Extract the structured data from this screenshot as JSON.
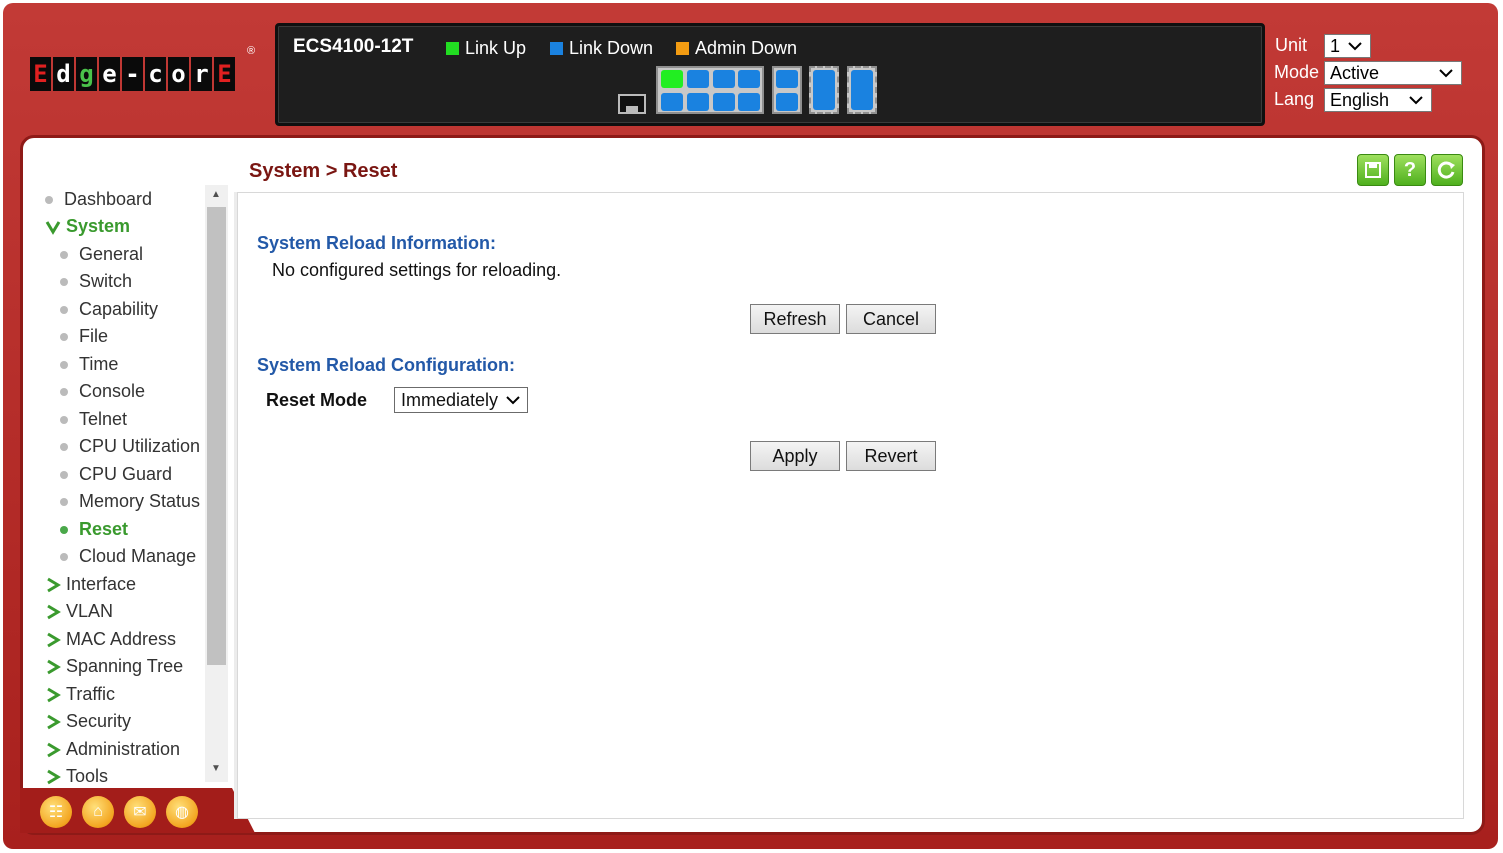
{
  "header": {
    "logo_letters": [
      "E",
      "d",
      "g",
      "e",
      "-",
      "c",
      "o",
      "r",
      "E"
    ],
    "logo_mark": "®",
    "model": "ECS4100-12T",
    "legend": [
      {
        "label": "Link Up",
        "color": "#22dd22"
      },
      {
        "label": "Link Down",
        "color": "#1a82e0"
      },
      {
        "label": "Admin Down",
        "color": "#f39c12"
      }
    ],
    "unit_label": "Unit",
    "unit_value": "1",
    "mode_label": "Mode",
    "mode_value": "Active",
    "lang_label": "Lang",
    "lang_value": "English"
  },
  "sidebar": {
    "items": [
      {
        "label": "Dashboard"
      },
      {
        "label": "System"
      },
      {
        "label": "General"
      },
      {
        "label": "Switch"
      },
      {
        "label": "Capability"
      },
      {
        "label": "File"
      },
      {
        "label": "Time"
      },
      {
        "label": "Console"
      },
      {
        "label": "Telnet"
      },
      {
        "label": "CPU Utilization"
      },
      {
        "label": "CPU Guard"
      },
      {
        "label": "Memory Status"
      },
      {
        "label": "Reset"
      },
      {
        "label": "Cloud Manage"
      },
      {
        "label": "Interface"
      },
      {
        "label": "VLAN"
      },
      {
        "label": "MAC Address"
      },
      {
        "label": "Spanning Tree"
      },
      {
        "label": "Traffic"
      },
      {
        "label": "Security"
      },
      {
        "label": "Administration"
      },
      {
        "label": "Tools"
      }
    ]
  },
  "main": {
    "breadcrumb": "System > Reset",
    "reload_info_title": "System Reload Information:",
    "reload_info_text": "No configured settings for reloading.",
    "refresh_label": "Refresh",
    "cancel_label": "Cancel",
    "reload_config_title": "System Reload Configuration:",
    "reset_mode_label": "Reset Mode",
    "reset_mode_value": "Immediately",
    "apply_label": "Apply",
    "revert_label": "Revert"
  },
  "colors": {
    "frame_red": "#b0231f",
    "accent_green": "#3a9a2e",
    "section_blue": "#2359a8",
    "breadcrumb_red": "#7a1612"
  }
}
